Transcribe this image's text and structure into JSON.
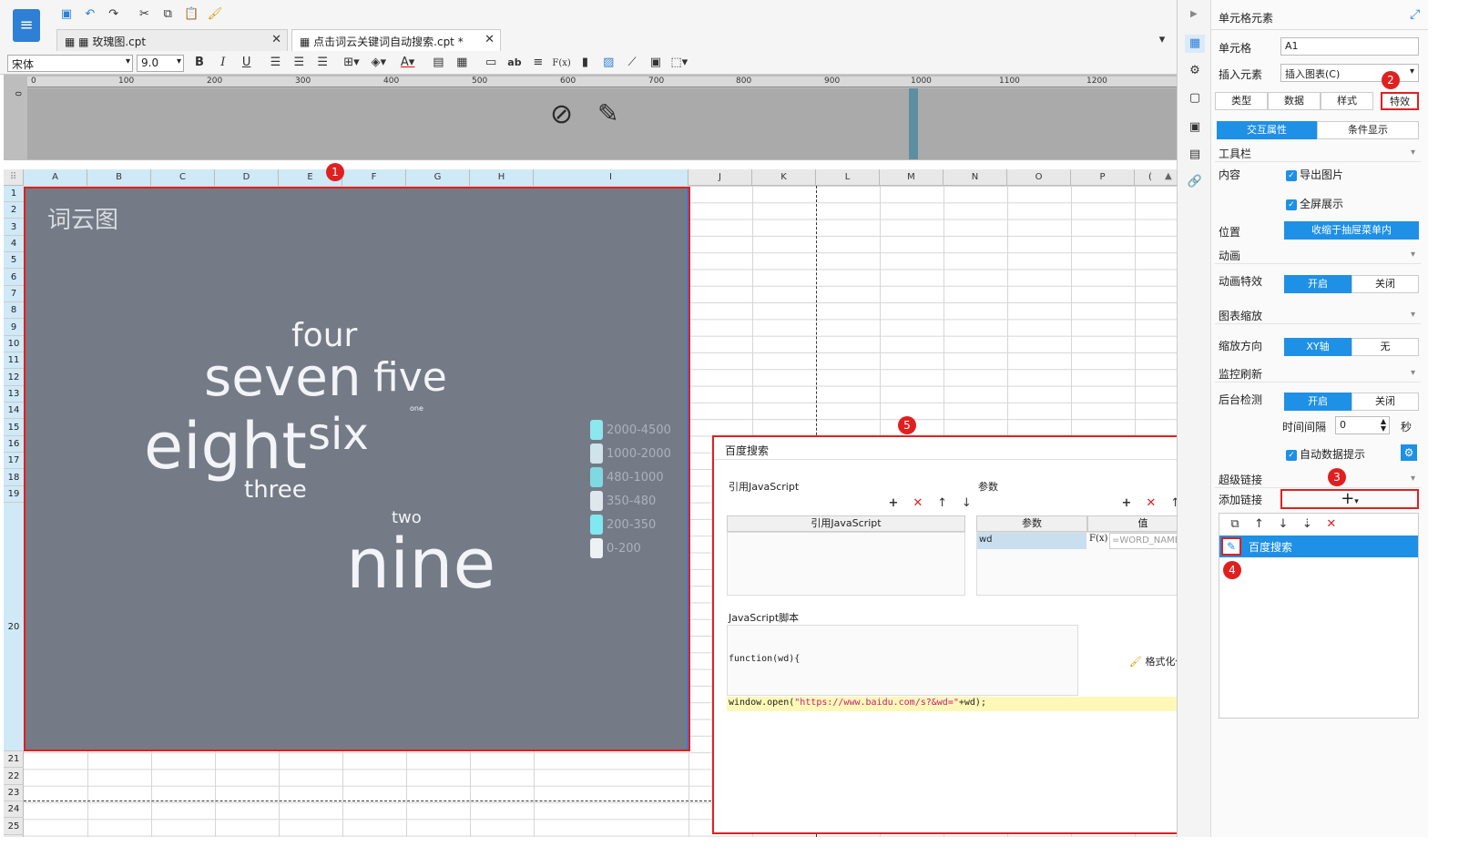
{
  "toolbar": {
    "font_name": "宋体",
    "font_size": "9.0",
    "bold": "B",
    "italic": "I",
    "underline": "U",
    "abc": "ab",
    "fx": "F(x)"
  },
  "tabs": [
    {
      "label": "玫瑰图.cpt"
    },
    {
      "label": "点击词云关键词自动搜索.cpt *"
    }
  ],
  "ruler": {
    "ticks": [
      "0",
      "100",
      "200",
      "300",
      "400",
      "500",
      "600",
      "700",
      "800",
      "900",
      "1000",
      "1100",
      "1200"
    ]
  },
  "columns": [
    "A",
    "B",
    "C",
    "D",
    "E",
    "F",
    "G",
    "H",
    "I",
    "J",
    "K",
    "L",
    "M",
    "N",
    "O",
    "P"
  ],
  "rows": [
    "1",
    "2",
    "3",
    "4",
    "5",
    "6",
    "7",
    "8",
    "9",
    "10",
    "11",
    "12",
    "13",
    "14",
    "15",
    "16",
    "17",
    "18",
    "19",
    "20",
    "21",
    "22",
    "23",
    "24",
    "25"
  ],
  "chart": {
    "title": "词云图",
    "words": [
      {
        "text": "four"
      },
      {
        "text": "seven"
      },
      {
        "text": "five"
      },
      {
        "text": "one"
      },
      {
        "text": "eight"
      },
      {
        "text": "six"
      },
      {
        "text": "three"
      },
      {
        "text": "two"
      },
      {
        "text": "nine"
      }
    ],
    "legend": [
      {
        "label": "2000-4500",
        "color": "#8ee6ee"
      },
      {
        "label": "1000-2000",
        "color": "#cfe3ea"
      },
      {
        "label": "480-1000",
        "color": "#7fd9e2"
      },
      {
        "label": "350-480",
        "color": "#dde7ec"
      },
      {
        "label": "200-350",
        "color": "#80e8f0"
      },
      {
        "label": "0-200",
        "color": "#edf1f4"
      }
    ]
  },
  "dialog": {
    "title": "百度搜索",
    "js_ref_label": "引用JavaScript",
    "js_ref_col": "引用JavaScript",
    "params_label": "参数",
    "param_col": "参数",
    "value_col": "值",
    "param_name": "wd",
    "param_value": "=WORD_NAME",
    "script_label": "JavaScript脚本",
    "func_sig": "function(wd){",
    "format_code": "格式化代码",
    "code_prefix": "window.open(",
    "code_string": "\"https://www.baidu.com/s?&wd=\"",
    "code_suffix": "+wd);"
  },
  "panel": {
    "title": "单元格元素",
    "cell_label": "单元格",
    "cell_value": "A1",
    "insert_label": "插入元素",
    "insert_value": "插入图表(C)",
    "tabs": [
      "类型",
      "数据",
      "样式",
      "特效"
    ],
    "subtabs": [
      "交互属性",
      "条件显示"
    ],
    "toolbar_section": "工具栏",
    "content_label": "内容",
    "export_image": "导出图片",
    "fullscreen": "全屏展示",
    "position_label": "位置",
    "position_value": "收缩于抽屉菜单内",
    "animation_section": "动画",
    "anim_label": "动画特效",
    "on": "开启",
    "off": "关闭",
    "zoom_section": "图表缩放",
    "zoom_dir_label": "缩放方向",
    "zoom_xy": "XY轴",
    "zoom_none": "无",
    "monitor_section": "监控刷新",
    "bg_check_label": "后台检测",
    "interval_label": "时间间隔",
    "interval_value": "0",
    "seconds": "秒",
    "auto_tip": "自动数据提示",
    "hyperlink_section": "超级链接",
    "add_link_label": "添加链接",
    "link_item": "百度搜索"
  },
  "badges": [
    "1",
    "2",
    "3",
    "4",
    "5"
  ],
  "colors": {
    "accent": "#1e90e6",
    "highlight": "#e02020",
    "chart_bg": "#747b86"
  }
}
